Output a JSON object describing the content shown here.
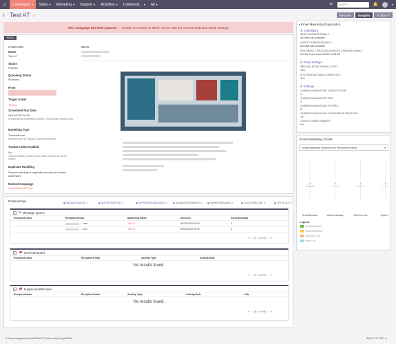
{
  "nav": {
    "items": [
      {
        "label": "Campaigns",
        "active": true
      },
      {
        "label": "Sales",
        "active": false
      },
      {
        "label": "Marketing",
        "active": false
      },
      {
        "label": "Support",
        "active": false
      },
      {
        "label": "Activities",
        "active": false
      },
      {
        "label": "Collaborat...",
        "active": false
      },
      {
        "label": "All",
        "active": false
      }
    ],
    "search_placeholder": "Search..."
  },
  "header": {
    "title": "Test #7",
    "actions": [
      "Resume",
      "Insights",
      "Actions"
    ]
  },
  "alert": {
    "bold": "This campaign has been paused",
    "text": "— Unable to connect to SMTP server with the current Outbound Email settings."
  },
  "record": {
    "tab": "BASIC",
    "campaign_head": "CAMPAIGN",
    "email_head": "EMAIL",
    "fields": [
      {
        "label": "Name",
        "value": "Test #7"
      },
      {
        "label": "Status",
        "value": "Paused"
      },
      {
        "label": "Queueing Status",
        "value": "Finished"
      },
      {
        "label": "From",
        "value": ""
      },
      {
        "label": "Target List(s)",
        "value": "Testing"
      },
      {
        "label": "Scheduled Run Date",
        "value": "05/19/2020 00:00",
        "hint": "Sending will be processed in batches. This may take several hours."
      },
      {
        "label": "Marketing Type",
        "value": "Transactional",
        "hint": "Recipients are NOT subject to opt-out restrictions."
      },
      {
        "label": "Tracker Links Enabled",
        "value": "No",
        "hint": "Trackers disabled (privacy, clean mode) and links will not be tracked."
      },
      {
        "label": "Duplicate Handling",
        "value": "Prevent sending to duplicate records and email addresses"
      },
      {
        "label": "Related Campaign",
        "value": "SuiteCRM 8.18 Test"
      }
    ]
  },
  "diagnostics": {
    "title": "Email Marketing Diagnostics",
    "schedulers": "Schedulers",
    "items1": [
      {
        "label": "SEND CAMPAIGN EMAILS",
        "value": "As often as possible"
      },
      {
        "label": "QUEUE CAMPAIGN EMAILS",
        "value": "As often as possible"
      },
      {
        "label": "RUN NIGHTLY PROCESS BOUNCED CAMPAIGN EMAILS",
        "value": "On the hour, from 02:00 to 06:00"
      }
    ],
    "email_settings": "Email Settings",
    "items2": [
      {
        "label": "INBOUND BOUNCE EMAIL EXIST?",
        "value": "Yes"
      },
      {
        "label": "IS OUTBOUND EMAIL CONNECTED?",
        "value": "Yes"
      }
    ],
    "settings": "Settings",
    "items3": [
      {
        "label": "CAMPAIGN MARKETING ITEMS PER RUN",
        "value": "1"
      },
      {
        "label": "CAMPAIGN EMAILS PER RUN",
        "value": "3"
      },
      {
        "label": "CAMPAIGN EMAILS MAX RETRIES",
        "value": "3"
      },
      {
        "label": "CAMPAIGN EMAILS MAX IN PROGRESS PER BATCH",
        "value": "10"
      },
      {
        "label": "TRACKER LINKS ENABLED",
        "value": "No"
      }
    ]
  },
  "charts": {
    "title": "Email Marketing Charts",
    "select": "Email Marketing Response by Recipient Activity",
    "legend_title": "Legend",
    "legend": [
      {
        "label": "Sent/Attempted",
        "color": "#6dba4c"
      },
      {
        "label": "Viewed Message",
        "color": "#f2c94c"
      },
      {
        "label": "Click-thru Link",
        "color": "#f4b183"
      },
      {
        "label": "Opted Out",
        "color": "#9fd6e6"
      }
    ]
  },
  "chart_data": {
    "type": "bar",
    "categories": [
      "Sent/Attempted",
      "Viewed Message",
      "Click-thru Link",
      "Opted Out"
    ],
    "values": [
      0,
      0,
      0,
      0
    ]
  },
  "relationships": {
    "title": "Relationships",
    "tabs": [
      "MESSAGE QUEUE: 2",
      "SENT/ATTEMPTED: 0",
      "SUPPRESSED/BLOCKED: 0",
      "BOUNCED MESSAGES: 0",
      "VIEWED MESSAGE: 0",
      "CLICK-THRU LINK: 0",
      "OPTED OUT: 0"
    ]
  },
  "panels": {
    "queue": {
      "title": "Message Queue",
      "columns": [
        "Recipient Name",
        "Recipient Email",
        "Marketing Name",
        "Send On",
        "Send Attempts"
      ],
      "rows": [
        [
          "",
          "...com",
          "Test #7",
          "05/20/2020 00:00",
          "0"
        ],
        [
          "",
          "...com",
          "Test #7",
          "05/20/2020 00:00",
          "0"
        ]
      ],
      "pager": "(1 - 2 of 2)"
    },
    "sent": {
      "title": "Sent/Attempted",
      "columns": [
        "Recipient Name",
        "Recipient Email",
        "Activity Type",
        "Activity Date"
      ],
      "empty": "No results found.",
      "pager": "(0 - 0 of 0)"
    },
    "blocked": {
      "title": "Suppressed/Blocked",
      "columns": [
        "Recipient Name",
        "Recipient Email",
        "Activity Type",
        "Activity Date",
        "Hits"
      ],
      "empty": "No results found.",
      "pager": "(0 - 0 of 0)"
    }
  },
  "footer": {
    "left": "© Supercharged by SuiteCRM   © Powered By SugarCRM",
    "right": "BACK TO TOP ▲"
  }
}
